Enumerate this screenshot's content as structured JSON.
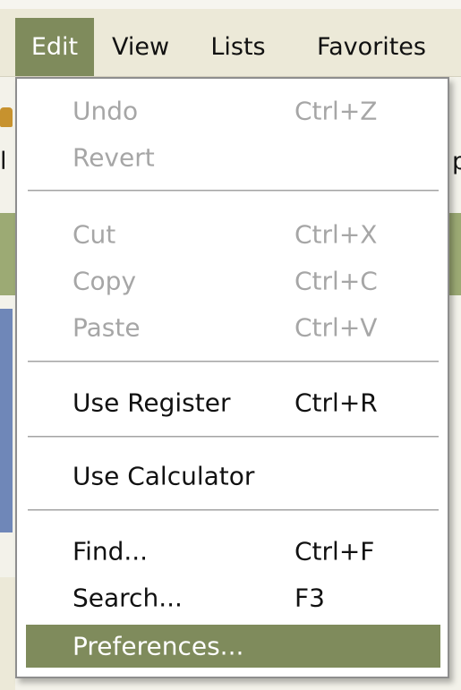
{
  "menubar": {
    "items": [
      {
        "label": "Edit",
        "active": true
      },
      {
        "label": "View",
        "active": false
      },
      {
        "label": "Lists",
        "active": false
      },
      {
        "label": "Favorites",
        "active": false
      }
    ]
  },
  "background": {
    "fragment_left_1": "l",
    "fragment_left_2": "l",
    "fragment_right": "p"
  },
  "edit_menu": {
    "items": [
      {
        "label": "Undo",
        "shortcut": "Ctrl+Z",
        "enabled": false
      },
      {
        "label": "Revert",
        "shortcut": "",
        "enabled": false
      },
      {
        "label": "Cut",
        "shortcut": "Ctrl+X",
        "enabled": false
      },
      {
        "label": "Copy",
        "shortcut": "Ctrl+C",
        "enabled": false
      },
      {
        "label": "Paste",
        "shortcut": "Ctrl+V",
        "enabled": false
      },
      {
        "label": "Use Register",
        "shortcut": "Ctrl+R",
        "enabled": true
      },
      {
        "label": "Use Calculator",
        "shortcut": "",
        "enabled": true
      },
      {
        "label": "Find...",
        "shortcut": "Ctrl+F",
        "enabled": true
      },
      {
        "label": "Search...",
        "shortcut": "F3",
        "enabled": true
      },
      {
        "label": "Preferences...",
        "shortcut": "",
        "enabled": true,
        "highlighted": true
      }
    ]
  },
  "colors": {
    "highlight": "#7f8b5c",
    "disabled_text": "#a6a6a6",
    "menu_background": "#ffffff",
    "app_background": "#ece9d8"
  }
}
